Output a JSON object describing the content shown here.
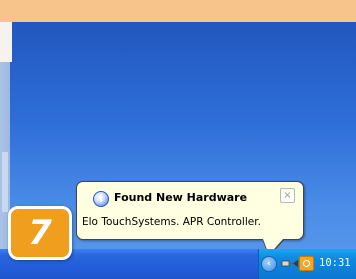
{
  "notification": {
    "title": "Found New Hardware",
    "message": "Elo TouchSystems. APR Controller.",
    "close_symbol": "×",
    "icon": "info-icon"
  },
  "taskbar": {
    "clock": "10:31",
    "tray_icons": [
      "tray-chevron-icon",
      "hardware-plug-icon",
      "elo-touch-icon"
    ]
  },
  "step_badge": {
    "number": "7"
  },
  "colors": {
    "balloon_bg": "#ffffe1",
    "taskbar_blue": "#245edb",
    "tray_blue": "#0f8ae0",
    "badge_orange": "#f09e1e",
    "page_bg": "#fbd7ab"
  }
}
